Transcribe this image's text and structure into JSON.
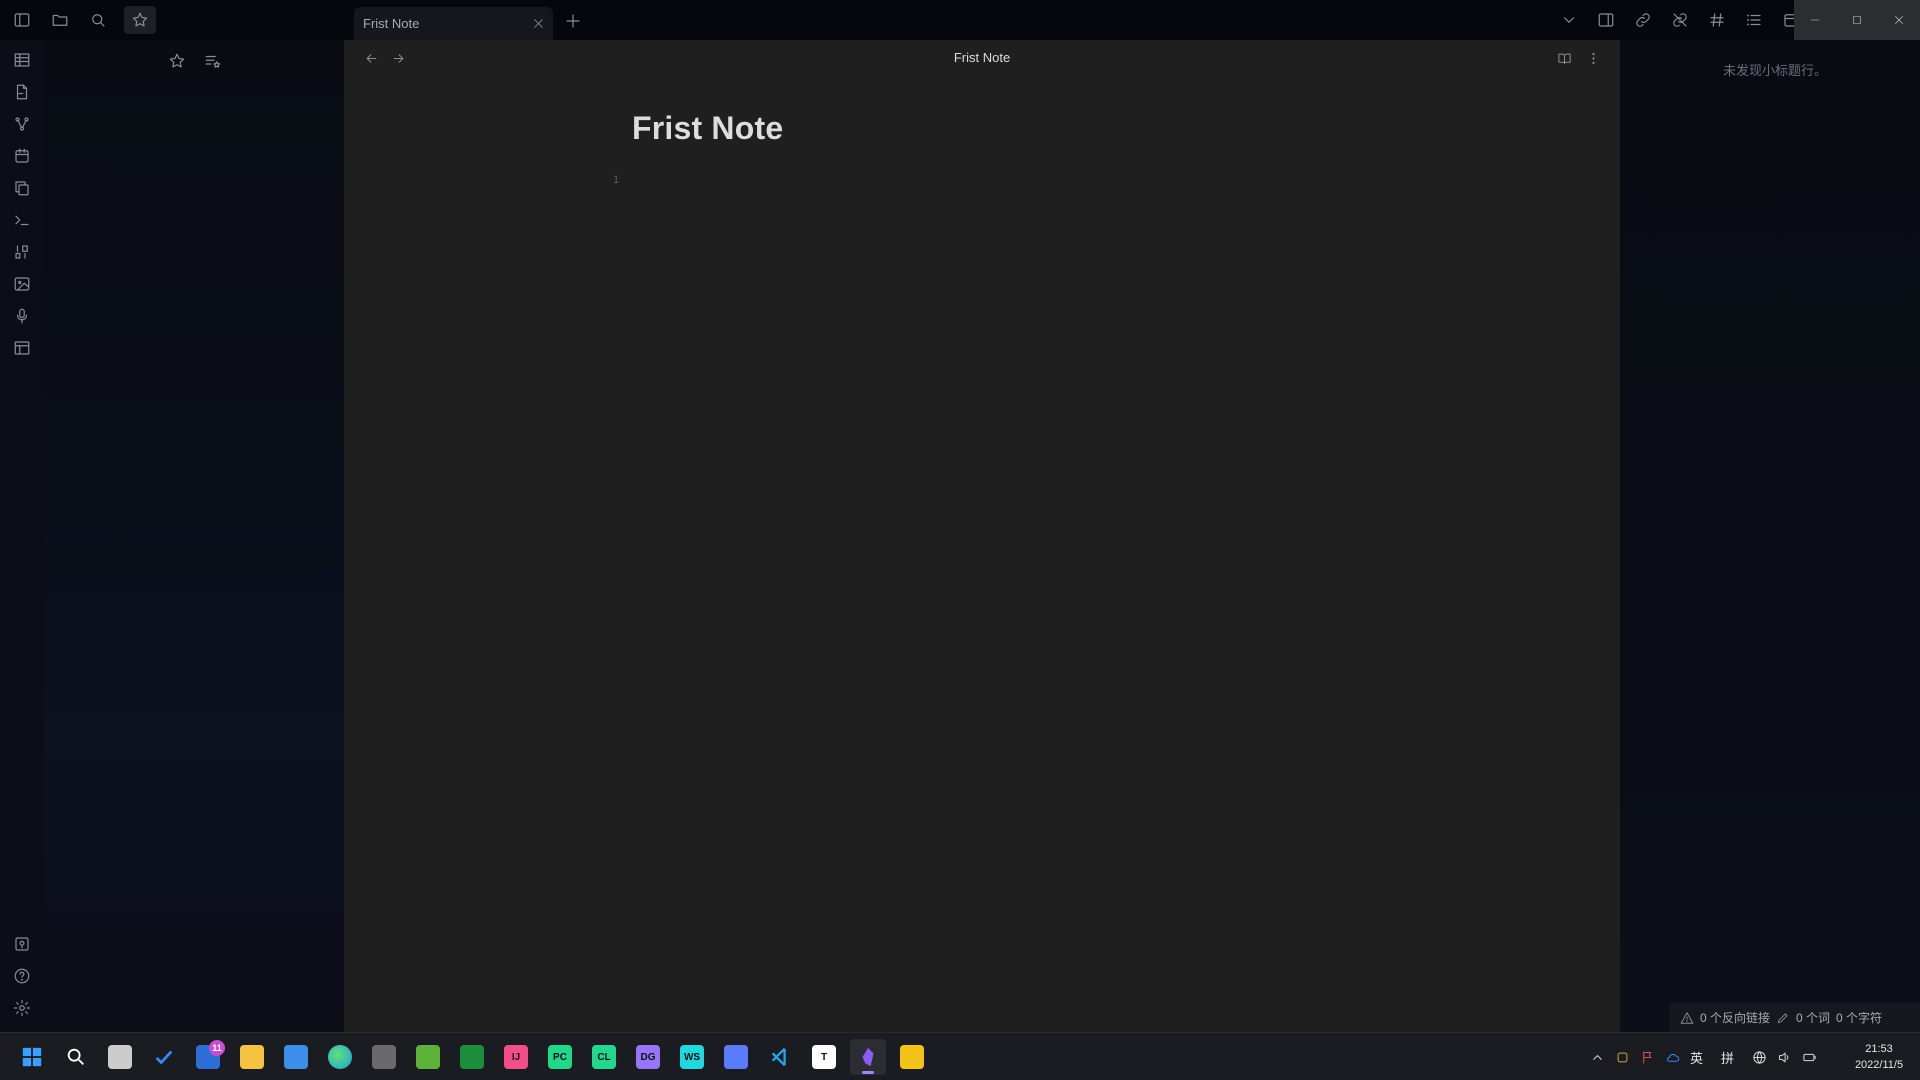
{
  "window": {
    "tab_title": "Frist Note"
  },
  "titlebar": {
    "left_icons": [
      "sidebar-toggle-icon",
      "folder-icon",
      "search-icon",
      "star-icon"
    ],
    "right_icons": [
      "chevron-down-icon",
      "split-view-icon",
      "link-icon",
      "unlink-icon",
      "hash-icon",
      "list-icon",
      "calendar-icon"
    ],
    "window_controls": [
      "minimize-icon",
      "maximize-icon",
      "close-icon"
    ]
  },
  "ribbon": {
    "items": [
      "table-icon",
      "file-import-icon",
      "graph-icon",
      "calendar-icon",
      "copy-icon",
      "terminal-icon",
      "sort-numeric-icon",
      "image-icon",
      "microphone-icon",
      "layout-icon"
    ],
    "bottom_items": [
      "vault-icon",
      "help-icon",
      "settings-icon"
    ]
  },
  "left_sidebar": {
    "actions": [
      "star-icon",
      "list-star-icon"
    ]
  },
  "editor": {
    "header_title": "Frist Note",
    "note_title": "Frist Note",
    "line_number": "1"
  },
  "right_panel": {
    "outline_empty": "未发现小标题行。"
  },
  "statusbar": {
    "backlinks": "0 个反向链接",
    "words": "0 个词",
    "chars": "0 个字符"
  },
  "taskbar": {
    "apps": [
      {
        "name": "start",
        "color": "#3aa0ff"
      },
      {
        "name": "search",
        "color": "#ffffff"
      },
      {
        "name": "task-view",
        "color": "#cccccc"
      },
      {
        "name": "todo",
        "color": "#2f8cff"
      },
      {
        "name": "teams",
        "color": "#2b6fd6",
        "badge": "11"
      },
      {
        "name": "file-explorer",
        "color": "#f5c242"
      },
      {
        "name": "store",
        "color": "#3b8eea"
      },
      {
        "name": "edge",
        "color": "#1fa0d8"
      },
      {
        "name": "app-gray",
        "color": "#6a6a6a"
      },
      {
        "name": "app-green",
        "color": "#5db33a"
      },
      {
        "name": "vim",
        "color": "#1c8d3b"
      },
      {
        "name": "intellij",
        "color": "#f24e87",
        "label": "IJ"
      },
      {
        "name": "pycharm",
        "color": "#21d789",
        "label": "PC"
      },
      {
        "name": "clion",
        "color": "#22d88f",
        "label": "CL"
      },
      {
        "name": "datagrip",
        "color": "#9775f8",
        "label": "DG"
      },
      {
        "name": "webstorm",
        "color": "#21d7e0",
        "label": "WS"
      },
      {
        "name": "app-blue",
        "color": "#5b7bff"
      },
      {
        "name": "vscode",
        "color": "#23a9f2"
      },
      {
        "name": "typora",
        "color": "#ffffff",
        "label": "T"
      },
      {
        "name": "obsidian",
        "color": "#8b5cf6",
        "active": true
      },
      {
        "name": "potplayer",
        "color": "#f2c318"
      }
    ],
    "tray": {
      "lang1": "英",
      "lang2": "拼"
    },
    "clock": {
      "time": "21:53",
      "date": "2022/11/5"
    }
  }
}
